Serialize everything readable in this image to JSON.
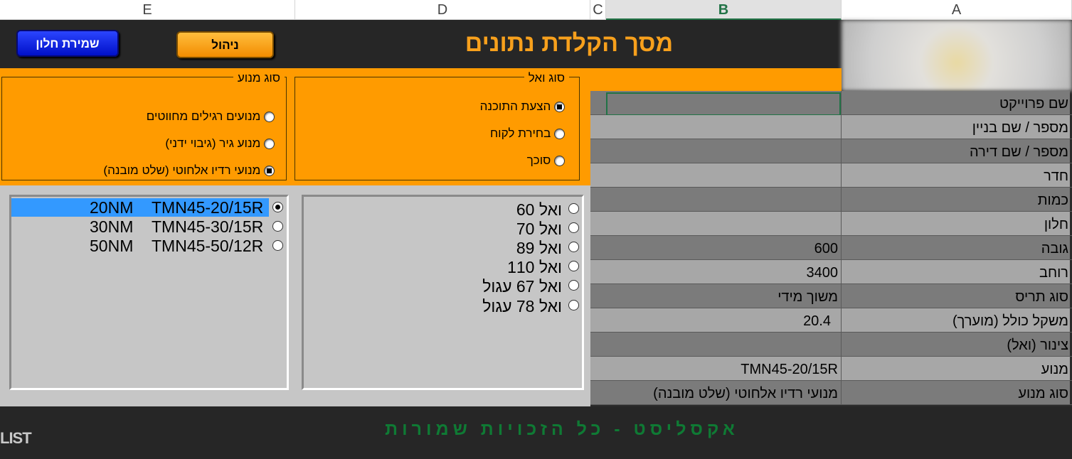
{
  "columns": [
    "E",
    "D",
    "C",
    "B",
    "A"
  ],
  "title": "מסך הקלדת נתונים",
  "buttons": {
    "save": "שמירת חלון",
    "manage": "ניהול"
  },
  "wall_type": {
    "legend": "סוג ואל",
    "options": [
      "הצעת התוכנה",
      "בחירת לקוח",
      "סוכך"
    ],
    "selected": "הצעת התוכנה"
  },
  "motor_type": {
    "legend": "סוג מנוע",
    "options": [
      "מנועים רגילים מחווטים",
      "מנוע גיר (גיבוי ידני)",
      "מנועי רדיו אלחוטי (שלט מובנה)"
    ],
    "selected": "מנועי רדיו אלחוטי (שלט מובנה)"
  },
  "wall_list": [
    "ואל 60",
    "ואל 70",
    "ואל 89",
    "ואל 110",
    "ואל 67 עגול",
    "ואל 78 עגול"
  ],
  "motor_list": [
    {
      "torque": "20NM",
      "model": "TMN45-20/15R",
      "selected": true
    },
    {
      "torque": "30NM",
      "model": "TMN45-30/15R",
      "selected": false
    },
    {
      "torque": "50NM",
      "model": "TMN45-50/12R",
      "selected": false
    }
  ],
  "table": [
    {
      "label": "שם פרוייקט",
      "value": ""
    },
    {
      "label": "מספר / שם בניין",
      "value": ""
    },
    {
      "label": "מספר / שם דירה",
      "value": ""
    },
    {
      "label": "חדר",
      "value": ""
    },
    {
      "label": "כמות",
      "value": ""
    },
    {
      "label": "חלון",
      "value": ""
    },
    {
      "label": "גובה",
      "value": "600"
    },
    {
      "label": "רוחב",
      "value": "3400"
    },
    {
      "label": "סוג תריס",
      "value": "משוך מידי"
    },
    {
      "label": "משקל כולל (מוערך)",
      "value": "20.4"
    },
    {
      "label": "צינור (ואל)",
      "value": ""
    },
    {
      "label": "מנוע",
      "value": "TMN45-20/15R"
    },
    {
      "label": "סוג מנוע",
      "value": "מנועי רדיו אלחוטי (שלט מובנה)"
    }
  ],
  "footer": {
    "copyright": "אקסליסט - כל הזכויות שמורות",
    "logo": "LIST"
  },
  "colors": {
    "orange": "#ff9b00",
    "title": "#f7a01c",
    "dark": "#262626",
    "save_button": "#0010c8",
    "footer_text": "#0f7a34"
  }
}
